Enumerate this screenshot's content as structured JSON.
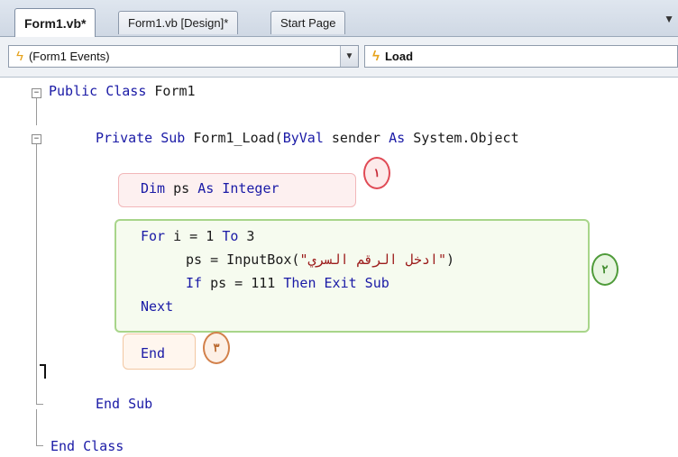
{
  "tabs": [
    {
      "label": "Form1.vb*",
      "active": true
    },
    {
      "label": "Form1.vb [Design]*",
      "active": false
    },
    {
      "label": "Start Page",
      "active": false
    }
  ],
  "tabstrip_overflow": "▼",
  "nav": {
    "class_combo": {
      "icon": "event-lightning-icon",
      "value": "(Form1 Events)"
    },
    "method_combo": {
      "icon": "event-lightning-icon",
      "value": "Load"
    }
  },
  "code": {
    "line1": {
      "kw": "Public Class",
      "rest": " Form1"
    },
    "line2": {
      "kw1": "Private Sub",
      "mid": " Form1_Load(",
      "kw2": "ByVal",
      "mid2": " sender ",
      "kw3": "As",
      "rest": " System.Object"
    },
    "line3": {
      "kw1": "Dim",
      "mid": " ps ",
      "kw2": "As Integer"
    },
    "line4": {
      "kw1": "For",
      "mid": " i = 1 ",
      "kw2": "To",
      "rest": " 3"
    },
    "line5": {
      "a": "ps = InputBox(",
      "q1": "\"",
      "arabic": "ادخل الرقم السري",
      "q2": "\"",
      "b": ")"
    },
    "line6": {
      "kw1": "If",
      "mid": " ps = 111 ",
      "kw2": "Then Exit Sub"
    },
    "line7": {
      "kw": "Next"
    },
    "line8": {
      "kw": "End"
    },
    "line9": {
      "kw": "End Sub"
    },
    "line10": {
      "kw": "End Class"
    }
  },
  "badges": {
    "one": "١",
    "two": "٢",
    "three": "٣"
  },
  "colors": {
    "keyword": "#1a1aa6",
    "string": "#9b1a1a",
    "highlight_red": "#f2b7b9",
    "highlight_green": "#a8d58a",
    "highlight_orange": "#f2c7a2"
  }
}
